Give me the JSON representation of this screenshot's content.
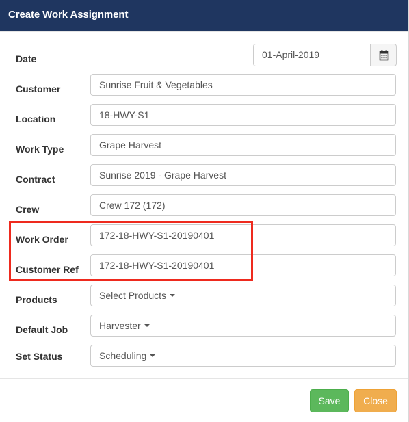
{
  "dialog": {
    "title": "Create Work Assignment"
  },
  "form": {
    "date": {
      "label": "Date",
      "value": "01-April-2019",
      "icon": "calendar-icon"
    },
    "customer": {
      "label": "Customer",
      "value": "Sunrise Fruit & Vegetables"
    },
    "location": {
      "label": "Location",
      "value": "18-HWY-S1"
    },
    "work_type": {
      "label": "Work Type",
      "value": "Grape Harvest"
    },
    "contract": {
      "label": "Contract",
      "value": "Sunrise 2019 - Grape Harvest"
    },
    "crew": {
      "label": "Crew",
      "value": "Crew 172 (172)"
    },
    "work_order": {
      "label": "Work Order",
      "value": "172-18-HWY-S1-20190401"
    },
    "customer_ref": {
      "label": "Customer Ref",
      "value": "172-18-HWY-S1-20190401"
    },
    "products": {
      "label": "Products",
      "value": "Select Products"
    },
    "default_job": {
      "label": "Default Job",
      "value": "Harvester"
    },
    "set_status": {
      "label": "Set Status",
      "value": "Scheduling"
    }
  },
  "footer": {
    "save_label": "Save",
    "close_label": "Close"
  },
  "colors": {
    "header_bg": "#1f3660",
    "save_bg": "#5cb85c",
    "close_bg": "#f0ad4e",
    "highlight": "#ee2a1e"
  }
}
